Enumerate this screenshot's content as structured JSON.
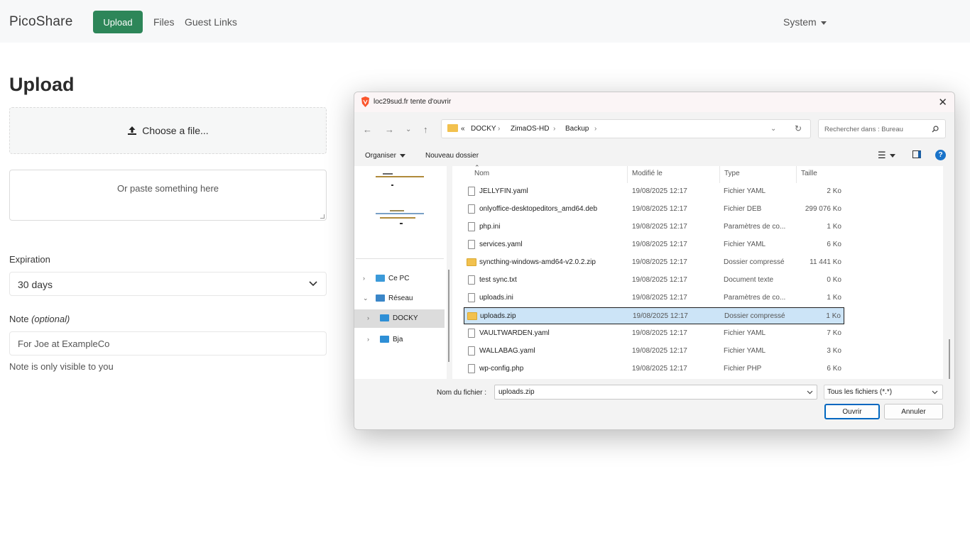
{
  "navbar": {
    "brand": "PicoShare",
    "upload": "Upload",
    "files": "Files",
    "guest_links": "Guest Links",
    "system": "System"
  },
  "page": {
    "title": "Upload",
    "choose_file": "Choose a file...",
    "paste_placeholder": "Or paste something here",
    "expiration_label": "Expiration",
    "expiration_value": "30 days",
    "note_label": "Note",
    "note_optional": "(optional)",
    "note_value": "For Joe at ExampleCo",
    "note_help": "Note is only visible to you"
  },
  "dialog": {
    "title": "loc29sud.fr tente d'ouvrir",
    "path": [
      "«",
      "DOCKY",
      "ZimaOS-HD",
      "Backup"
    ],
    "search_placeholder": "Rechercher dans : Bureau",
    "toolbar": {
      "organize": "Organiser",
      "new_folder": "Nouveau dossier"
    },
    "tree": [
      {
        "label": "Ce PC",
        "chevron": "›"
      },
      {
        "label": "Réseau",
        "chevron": "⌄"
      },
      {
        "label": "DOCKY",
        "chevron": "›"
      },
      {
        "label": "Bja",
        "chevron": "›"
      }
    ],
    "columns": {
      "name": "Nom",
      "modified": "Modifié le",
      "type": "Type",
      "size": "Taille"
    },
    "files": [
      {
        "name": "JELLYFIN.yaml",
        "date": "19/08/2025 12:17",
        "type": "Fichier YAML",
        "size": "2 Ko",
        "zip": false
      },
      {
        "name": "onlyoffice-desktopeditors_amd64.deb",
        "date": "19/08/2025 12:17",
        "type": "Fichier DEB",
        "size": "299 076 Ko",
        "zip": false
      },
      {
        "name": "php.ini",
        "date": "19/08/2025 12:17",
        "type": "Paramètres de co...",
        "size": "1 Ko",
        "zip": false
      },
      {
        "name": "services.yaml",
        "date": "19/08/2025 12:17",
        "type": "Fichier YAML",
        "size": "6 Ko",
        "zip": false
      },
      {
        "name": "syncthing-windows-amd64-v2.0.2.zip",
        "date": "19/08/2025 12:17",
        "type": "Dossier compressé",
        "size": "11 441 Ko",
        "zip": true
      },
      {
        "name": "test sync.txt",
        "date": "19/08/2025 12:17",
        "type": "Document texte",
        "size": "0 Ko",
        "zip": false
      },
      {
        "name": "uploads.ini",
        "date": "19/08/2025 12:17",
        "type": "Paramètres de co...",
        "size": "1 Ko",
        "zip": false
      },
      {
        "name": "uploads.zip",
        "date": "19/08/2025 12:17",
        "type": "Dossier compressé",
        "size": "1 Ko",
        "zip": true
      },
      {
        "name": "VAULTWARDEN.yaml",
        "date": "19/08/2025 12:17",
        "type": "Fichier YAML",
        "size": "7 Ko",
        "zip": false
      },
      {
        "name": "WALLABAG.yaml",
        "date": "19/08/2025 12:17",
        "type": "Fichier YAML",
        "size": "3 Ko",
        "zip": false
      },
      {
        "name": "wp-config.php",
        "date": "19/08/2025 12:17",
        "type": "Fichier PHP",
        "size": "6 Ko",
        "zip": false
      }
    ],
    "filename_label": "Nom du fichier :",
    "filename_value": "uploads.zip",
    "filetype_value": "Tous les fichiers (*.*)",
    "open_button": "Ouvrir",
    "cancel_button": "Annuler"
  },
  "colors": {
    "primary": "#2d8659",
    "selection": "#cce4f7",
    "accent": "#0067c0"
  }
}
